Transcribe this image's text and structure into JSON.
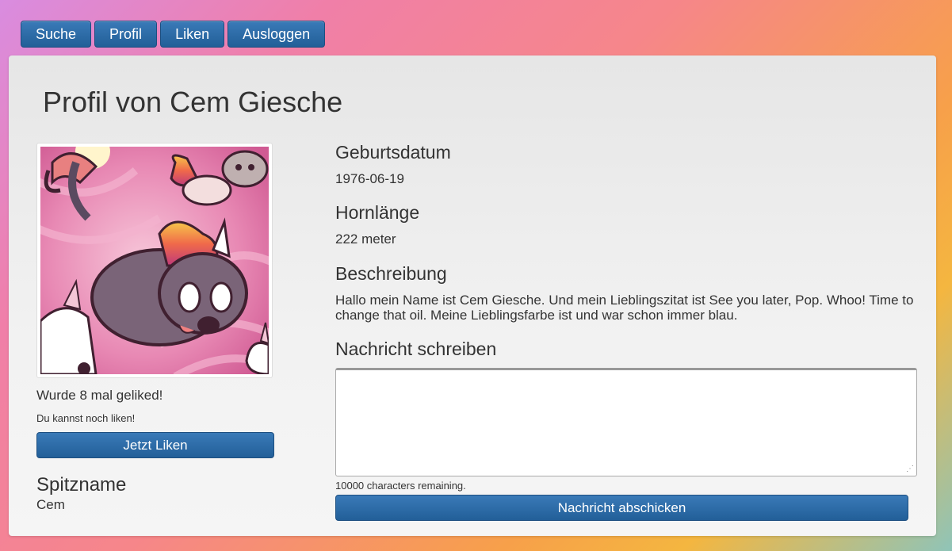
{
  "nav": {
    "items": [
      {
        "label": "Suche"
      },
      {
        "label": "Profil"
      },
      {
        "label": "Liken"
      },
      {
        "label": "Ausloggen"
      }
    ]
  },
  "profile": {
    "title": "Profil von Cem Giesche",
    "likes_text": "Wurde 8 mal geliked!",
    "like_hint": "Du kannst noch liken!",
    "like_button": "Jetzt Liken",
    "nickname_heading": "Spitzname",
    "nickname_value": "Cem",
    "birthdate_heading": "Geburtsdatum",
    "birthdate_value": "1976-06-19",
    "horn_heading": "Hornlänge",
    "horn_value": "222 meter",
    "description_heading": "Beschreibung",
    "description_value": "Hallo mein Name ist Cem Giesche. Und mein Lieblingszitat ist See you later, Pop. Whoo! Time to change that oil. Meine Lieblingsfarbe ist und war schon immer blau."
  },
  "message": {
    "heading": "Nachricht schreiben",
    "text": "",
    "remaining": "10000 characters remaining.",
    "send_button": "Nachricht abschicken"
  },
  "colors": {
    "button": "#2a6aa8",
    "card": "#eeeeee"
  }
}
